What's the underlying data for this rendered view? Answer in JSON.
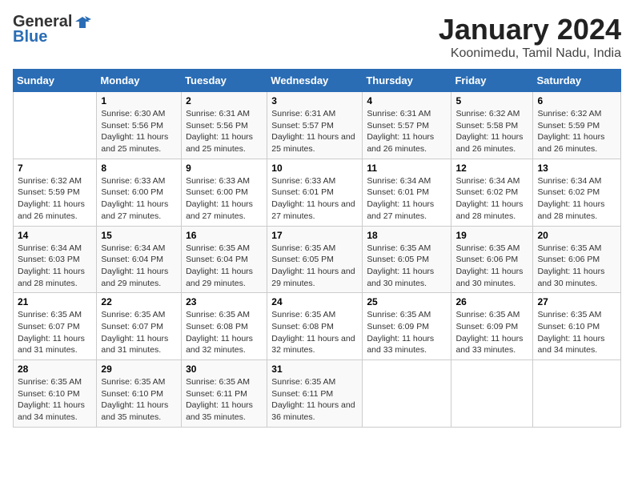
{
  "header": {
    "logo_general": "General",
    "logo_blue": "Blue",
    "title": "January 2024",
    "subtitle": "Koonimedu, Tamil Nadu, India"
  },
  "calendar": {
    "days_of_week": [
      "Sunday",
      "Monday",
      "Tuesday",
      "Wednesday",
      "Thursday",
      "Friday",
      "Saturday"
    ],
    "weeks": [
      [
        {
          "day": "",
          "sunrise": "",
          "sunset": "",
          "daylight": ""
        },
        {
          "day": "1",
          "sunrise": "Sunrise: 6:30 AM",
          "sunset": "Sunset: 5:56 PM",
          "daylight": "Daylight: 11 hours and 25 minutes."
        },
        {
          "day": "2",
          "sunrise": "Sunrise: 6:31 AM",
          "sunset": "Sunset: 5:56 PM",
          "daylight": "Daylight: 11 hours and 25 minutes."
        },
        {
          "day": "3",
          "sunrise": "Sunrise: 6:31 AM",
          "sunset": "Sunset: 5:57 PM",
          "daylight": "Daylight: 11 hours and 25 minutes."
        },
        {
          "day": "4",
          "sunrise": "Sunrise: 6:31 AM",
          "sunset": "Sunset: 5:57 PM",
          "daylight": "Daylight: 11 hours and 26 minutes."
        },
        {
          "day": "5",
          "sunrise": "Sunrise: 6:32 AM",
          "sunset": "Sunset: 5:58 PM",
          "daylight": "Daylight: 11 hours and 26 minutes."
        },
        {
          "day": "6",
          "sunrise": "Sunrise: 6:32 AM",
          "sunset": "Sunset: 5:59 PM",
          "daylight": "Daylight: 11 hours and 26 minutes."
        }
      ],
      [
        {
          "day": "7",
          "sunrise": "Sunrise: 6:32 AM",
          "sunset": "Sunset: 5:59 PM",
          "daylight": "Daylight: 11 hours and 26 minutes."
        },
        {
          "day": "8",
          "sunrise": "Sunrise: 6:33 AM",
          "sunset": "Sunset: 6:00 PM",
          "daylight": "Daylight: 11 hours and 27 minutes."
        },
        {
          "day": "9",
          "sunrise": "Sunrise: 6:33 AM",
          "sunset": "Sunset: 6:00 PM",
          "daylight": "Daylight: 11 hours and 27 minutes."
        },
        {
          "day": "10",
          "sunrise": "Sunrise: 6:33 AM",
          "sunset": "Sunset: 6:01 PM",
          "daylight": "Daylight: 11 hours and 27 minutes."
        },
        {
          "day": "11",
          "sunrise": "Sunrise: 6:34 AM",
          "sunset": "Sunset: 6:01 PM",
          "daylight": "Daylight: 11 hours and 27 minutes."
        },
        {
          "day": "12",
          "sunrise": "Sunrise: 6:34 AM",
          "sunset": "Sunset: 6:02 PM",
          "daylight": "Daylight: 11 hours and 28 minutes."
        },
        {
          "day": "13",
          "sunrise": "Sunrise: 6:34 AM",
          "sunset": "Sunset: 6:02 PM",
          "daylight": "Daylight: 11 hours and 28 minutes."
        }
      ],
      [
        {
          "day": "14",
          "sunrise": "Sunrise: 6:34 AM",
          "sunset": "Sunset: 6:03 PM",
          "daylight": "Daylight: 11 hours and 28 minutes."
        },
        {
          "day": "15",
          "sunrise": "Sunrise: 6:34 AM",
          "sunset": "Sunset: 6:04 PM",
          "daylight": "Daylight: 11 hours and 29 minutes."
        },
        {
          "day": "16",
          "sunrise": "Sunrise: 6:35 AM",
          "sunset": "Sunset: 6:04 PM",
          "daylight": "Daylight: 11 hours and 29 minutes."
        },
        {
          "day": "17",
          "sunrise": "Sunrise: 6:35 AM",
          "sunset": "Sunset: 6:05 PM",
          "daylight": "Daylight: 11 hours and 29 minutes."
        },
        {
          "day": "18",
          "sunrise": "Sunrise: 6:35 AM",
          "sunset": "Sunset: 6:05 PM",
          "daylight": "Daylight: 11 hours and 30 minutes."
        },
        {
          "day": "19",
          "sunrise": "Sunrise: 6:35 AM",
          "sunset": "Sunset: 6:06 PM",
          "daylight": "Daylight: 11 hours and 30 minutes."
        },
        {
          "day": "20",
          "sunrise": "Sunrise: 6:35 AM",
          "sunset": "Sunset: 6:06 PM",
          "daylight": "Daylight: 11 hours and 30 minutes."
        }
      ],
      [
        {
          "day": "21",
          "sunrise": "Sunrise: 6:35 AM",
          "sunset": "Sunset: 6:07 PM",
          "daylight": "Daylight: 11 hours and 31 minutes."
        },
        {
          "day": "22",
          "sunrise": "Sunrise: 6:35 AM",
          "sunset": "Sunset: 6:07 PM",
          "daylight": "Daylight: 11 hours and 31 minutes."
        },
        {
          "day": "23",
          "sunrise": "Sunrise: 6:35 AM",
          "sunset": "Sunset: 6:08 PM",
          "daylight": "Daylight: 11 hours and 32 minutes."
        },
        {
          "day": "24",
          "sunrise": "Sunrise: 6:35 AM",
          "sunset": "Sunset: 6:08 PM",
          "daylight": "Daylight: 11 hours and 32 minutes."
        },
        {
          "day": "25",
          "sunrise": "Sunrise: 6:35 AM",
          "sunset": "Sunset: 6:09 PM",
          "daylight": "Daylight: 11 hours and 33 minutes."
        },
        {
          "day": "26",
          "sunrise": "Sunrise: 6:35 AM",
          "sunset": "Sunset: 6:09 PM",
          "daylight": "Daylight: 11 hours and 33 minutes."
        },
        {
          "day": "27",
          "sunrise": "Sunrise: 6:35 AM",
          "sunset": "Sunset: 6:10 PM",
          "daylight": "Daylight: 11 hours and 34 minutes."
        }
      ],
      [
        {
          "day": "28",
          "sunrise": "Sunrise: 6:35 AM",
          "sunset": "Sunset: 6:10 PM",
          "daylight": "Daylight: 11 hours and 34 minutes."
        },
        {
          "day": "29",
          "sunrise": "Sunrise: 6:35 AM",
          "sunset": "Sunset: 6:10 PM",
          "daylight": "Daylight: 11 hours and 35 minutes."
        },
        {
          "day": "30",
          "sunrise": "Sunrise: 6:35 AM",
          "sunset": "Sunset: 6:11 PM",
          "daylight": "Daylight: 11 hours and 35 minutes."
        },
        {
          "day": "31",
          "sunrise": "Sunrise: 6:35 AM",
          "sunset": "Sunset: 6:11 PM",
          "daylight": "Daylight: 11 hours and 36 minutes."
        },
        {
          "day": "",
          "sunrise": "",
          "sunset": "",
          "daylight": ""
        },
        {
          "day": "",
          "sunrise": "",
          "sunset": "",
          "daylight": ""
        },
        {
          "day": "",
          "sunrise": "",
          "sunset": "",
          "daylight": ""
        }
      ]
    ]
  }
}
